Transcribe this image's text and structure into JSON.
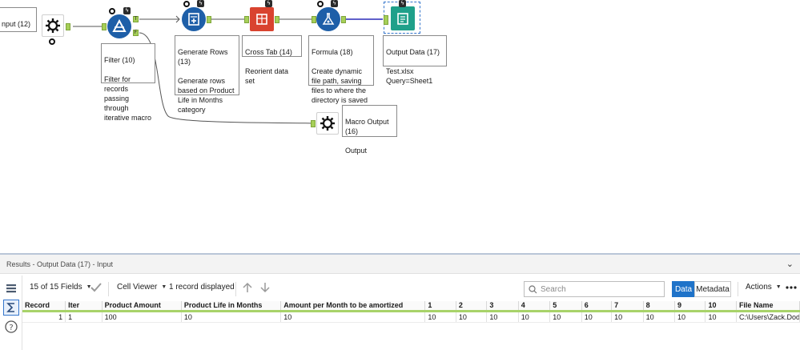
{
  "canvas": {
    "input_annotation": "nput (12)",
    "tools": [
      {
        "id": "macro-input",
        "icon": "macro-input-icon"
      },
      {
        "id": "filter",
        "icon": "filter-icon",
        "anno_title": "Filter (10)",
        "anno_desc": "Filter for records passing through iterative macro",
        "out_true": "T",
        "out_false": "F"
      },
      {
        "id": "generate-rows",
        "icon": "generate-rows-icon",
        "anno_title": "Generate Rows (13)",
        "anno_desc": "Generate rows based on Product Life in Months category"
      },
      {
        "id": "cross-tab",
        "icon": "cross-tab-icon",
        "anno_title": "Cross Tab (14)",
        "anno_desc": "Reorient data set"
      },
      {
        "id": "formula",
        "icon": "formula-icon",
        "anno_title": "Formula (18)",
        "anno_desc": "Create dynamic file path, saving files to where the directory is saved"
      },
      {
        "id": "output-data",
        "icon": "output-data-icon",
        "anno_title": "Output Data (17)",
        "anno_desc": "Test.xlsx\nQuery=Sheet1"
      },
      {
        "id": "macro-output",
        "icon": "macro-output-icon",
        "anno_title": "Macro Output (16)",
        "anno_desc": "Output"
      }
    ]
  },
  "results": {
    "title": "Results - Output Data (17) - Input",
    "fields_label": "15 of 15 Fields",
    "cell_viewer_label": "Cell Viewer",
    "record_count_label": "1 record displayed",
    "search_placeholder": "Search",
    "data_tab": "Data",
    "metadata_tab": "Metadata",
    "actions_label": "Actions",
    "columns": [
      "Record",
      "Iter",
      "Product Amount",
      "Product Life in Months",
      "Amount per Month to be amortized",
      "1",
      "2",
      "3",
      "4",
      "5",
      "6",
      "7",
      "8",
      "9",
      "10",
      "File Name"
    ],
    "rows": [
      [
        "1",
        "1",
        "100",
        "10",
        "10",
        "10",
        "10",
        "10",
        "10",
        "10",
        "10",
        "10",
        "10",
        "10",
        "10",
        "C:\\Users\\Zack.Dodson"
      ]
    ]
  },
  "colors": {
    "accent_blue": "#1f73c9",
    "tool_blue": "#1e5fa8",
    "cross_tab_red": "#d9432f",
    "output_teal": "#1fa08a",
    "connector_green": "#a6cf58"
  }
}
